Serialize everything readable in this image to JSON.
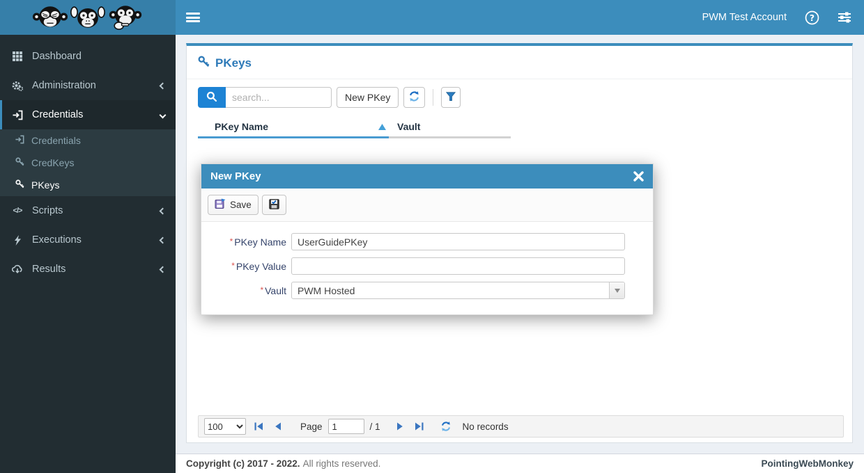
{
  "colors": {
    "navbar": "#3c8dbc",
    "logo_bg": "#367fa9",
    "sidebar_bg": "#222d32",
    "submenu_bg": "#2c3b41",
    "active_item_bg": "#1e282c",
    "accent_blue": "#3c8dbc",
    "search_button_blue": "#1d83d4",
    "title_blue": "#2e7ab8",
    "content_bg": "#ecf0f5",
    "required_red": "#d9534f"
  },
  "topbar": {
    "account": "PWM Test Account"
  },
  "sidebar": {
    "items": [
      {
        "label": "Dashboard"
      },
      {
        "label": "Administration"
      },
      {
        "label": "Credentials",
        "children": [
          {
            "label": "Credentials"
          },
          {
            "label": "CredKeys"
          },
          {
            "label": "PKeys"
          }
        ]
      },
      {
        "label": "Scripts"
      },
      {
        "label": "Executions"
      },
      {
        "label": "Results"
      }
    ]
  },
  "page": {
    "title": "PKeys",
    "search_placeholder": "search...",
    "new_button_label": "New PKey",
    "columns": [
      {
        "label": "PKey Name"
      },
      {
        "label": "Vault"
      }
    ],
    "pager": {
      "page_size": "100",
      "page_label": "Page",
      "current_page": "1",
      "total_pages": "/ 1",
      "status": "No records"
    }
  },
  "modal": {
    "title": "New PKey",
    "save_label": "Save",
    "required_marker": "*",
    "fields": [
      {
        "label": "PKey Name",
        "value": "UserGuidePKey"
      },
      {
        "label": "PKey Value",
        "value": ""
      },
      {
        "label": "Vault",
        "value": "PWM Hosted"
      }
    ]
  },
  "footer": {
    "copyright_strong": "Copyright (c) 2017 - 2022.",
    "copyright_text": "All rights reserved.",
    "brand": "PointingWebMonkey"
  }
}
